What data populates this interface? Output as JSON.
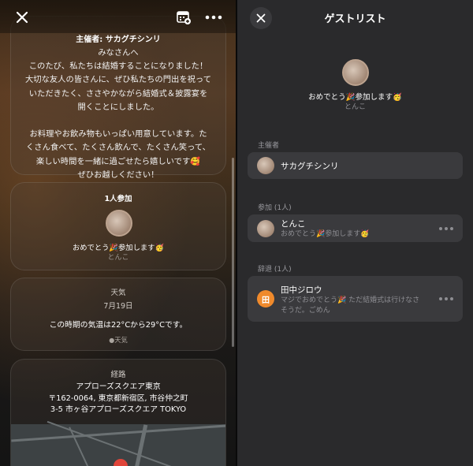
{
  "left": {
    "invitation": {
      "host_line": "主催者: サカグチシンリ",
      "message": "みなさんへ\nこのたび、私たちは結婚することになりました！\n大切な友人の皆さんに、ぜひ私たちの門出を祝って\nいただきたく、ささやかながら結婚式＆披露宴を\n開くことにしました。\n\nお料理やお飲み物もいっぱい用意しています。た\nくさん食べて、たくさん飲んで、たくさん笑って、\n楽しい時間を一緒に過ごせたら嬉しいです🥰\nぜひお越しください！"
    },
    "attendance": {
      "title": "1人参加",
      "message": "おめでとう🎉参加します🥳",
      "name": "とんこ"
    },
    "weather": {
      "title": "天気",
      "date": "7月19日",
      "text": "この時期の気温は22°Cから29°Cです。",
      "source": "天気"
    },
    "route": {
      "title": "経路",
      "address": "アプローズスクエア東京\n〒162-0064, 東京都新宿区, 市谷仲之町\n3-5 市ヶ谷アプローズスクエア TOKYO"
    }
  },
  "right": {
    "header": "ゲストリスト",
    "top_status": "おめでとう🎉参加します🥳",
    "top_name": "とんこ",
    "host_section": "主催者",
    "host_name": "サカグチシンリ",
    "attending_section": "参加 (1人)",
    "attending": {
      "name": "とんこ",
      "message": "おめでとう🎉参加します🥳"
    },
    "declined_section": "辞退 (1人)",
    "declined": {
      "initial": "田",
      "name": "田中ジロウ",
      "message": "マジでおめでとう🎉 ただ結婚式は行けなさ\nそうだ。ごめん"
    }
  },
  "colors": {
    "avatar_orange": "#f08a2c",
    "panel_bg": "#2a2a2c",
    "row_bg": "#3a3a3d"
  }
}
